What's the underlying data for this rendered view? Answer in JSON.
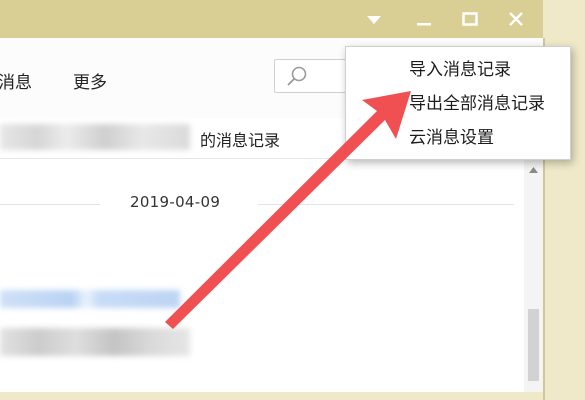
{
  "toolbar": {
    "tab_messages_partial": "消息",
    "more_label": "更多"
  },
  "tabs_row": {
    "records_partial": "的消息记录"
  },
  "content": {
    "date": "2019-04-09"
  },
  "context_menu": {
    "items": [
      {
        "label": "导入消息记录"
      },
      {
        "label": "导出全部消息记录"
      },
      {
        "label": "云消息设置"
      }
    ]
  },
  "icons": {
    "dropdown": "triangle-down-icon",
    "minimize": "minimize-icon",
    "maximize": "maximize-icon",
    "close": "close-icon",
    "search": "search-icon",
    "scroll_up": "triangle-up-icon"
  },
  "colors": {
    "titlebar": "#d9cf95",
    "frame": "#efe9c9",
    "annotation_arrow": "#f0474a"
  }
}
